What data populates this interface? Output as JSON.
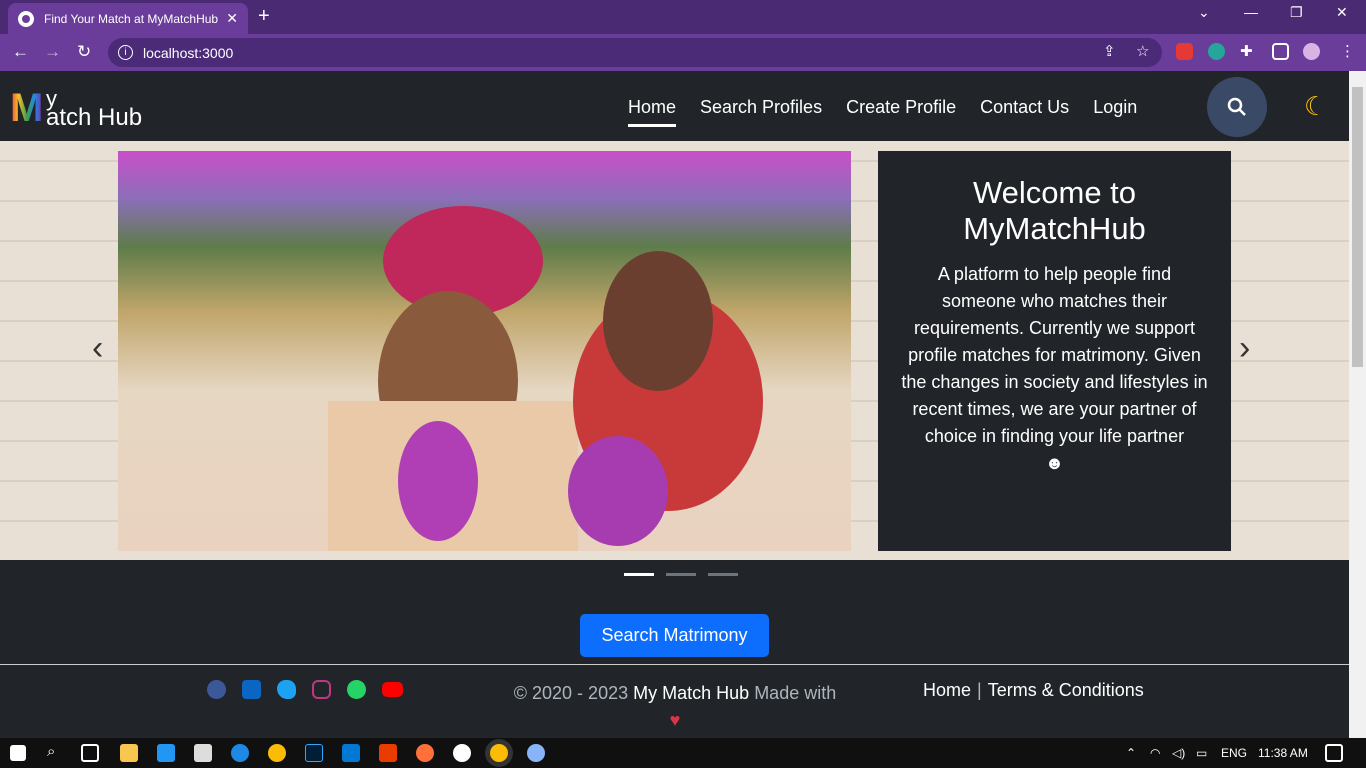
{
  "browser": {
    "tab_title": "Find Your Match at MyMatchHub",
    "url": "localhost:3000"
  },
  "site": {
    "logo_big": "M",
    "logo_small": "y",
    "logo_rest": "atch Hub",
    "nav": [
      "Home",
      "Search Profiles",
      "Create Profile",
      "Contact Us",
      "Login"
    ],
    "active_nav": "Home"
  },
  "hero": {
    "title": "Welcome to MyMatchHub",
    "description": "A platform to help people find someone who matches their requirements. Currently we support profile matches for matrimony. Given the changes in society and lifestyles in recent times, we are your partner of choice in finding your life partner",
    "emoji": "☻",
    "slide_count": 3,
    "active_slide": 1
  },
  "cta": {
    "label": "Search Matrimony"
  },
  "footer": {
    "socials": [
      "facebook-icon",
      "linkedin-icon",
      "twitter-icon",
      "instagram-icon",
      "whatsapp-icon",
      "youtube-icon"
    ],
    "copyright_prefix": "© 2020 - 2023",
    "brand": "My Match Hub",
    "made_with": "Made with",
    "heart": "♥",
    "links": [
      "Home",
      "Terms & Conditions"
    ]
  },
  "taskbar": {
    "lang": "ENG",
    "time": "11:38 AM"
  },
  "colors": {
    "primary": "#0d6efd",
    "dark": "#212529",
    "browser_accent": "#6a3d9a"
  }
}
